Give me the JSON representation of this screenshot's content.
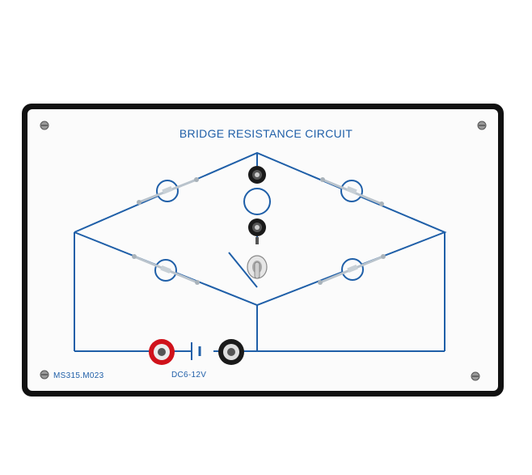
{
  "panel": {
    "title": "BRIDGE RESISTANCE CIRCUIT",
    "model_number": "MS315.M023",
    "voltage_label": "DC6-12V"
  },
  "colors": {
    "background": "#ffffff",
    "frame": "#111111",
    "panel_face": "#fbfbfb",
    "circuit_line": "#1f5fa8",
    "socket_red": "#d0121b",
    "socket_black": "#1a1a1a",
    "screw": "#8a8a8a"
  },
  "components": {
    "bulb_holders": 5,
    "test_sockets": 4,
    "switch": "knife-switch-icon"
  }
}
